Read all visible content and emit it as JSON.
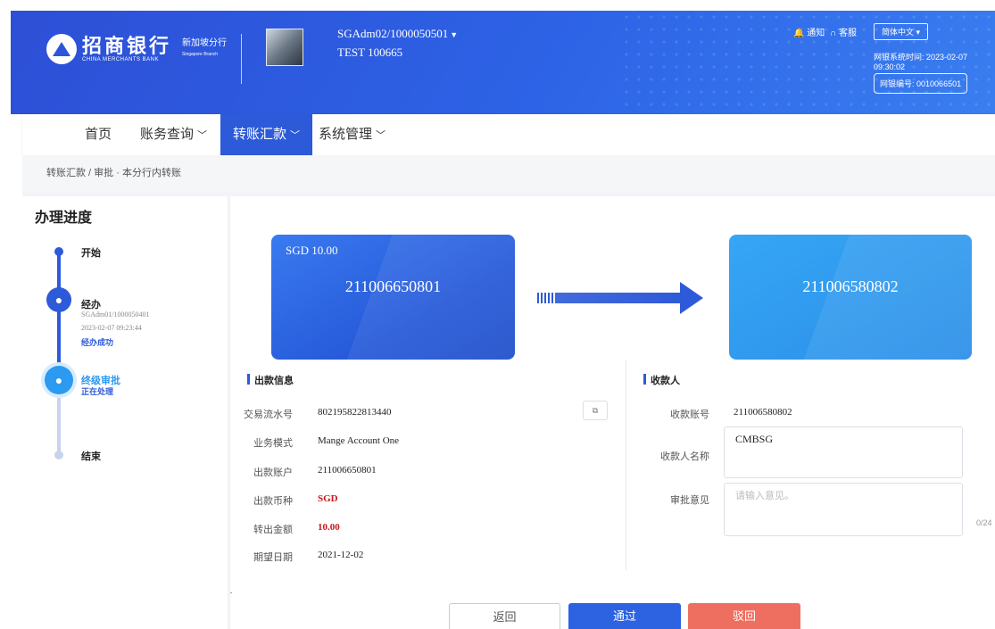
{
  "header": {
    "brand_cn": "招商银行",
    "brand_en": "CHINA MERCHANTS BANK",
    "branch_cn": "新加坡分行",
    "branch_en": "Singapore Branch",
    "user_line1": "SGAdm02/1000050501",
    "user_line2": "TEST 100665",
    "notice_label": "通知",
    "service_label": "客服",
    "language": "简体中文",
    "system_time_label": "网银系统时间:",
    "system_time_value": "2023-02-07 09:30:02",
    "netbank_id_label": "网银编号:",
    "netbank_id_value": "0010066501"
  },
  "nav": {
    "items": [
      {
        "label": "首页"
      },
      {
        "label": "账务查询"
      },
      {
        "label": "转账汇款"
      },
      {
        "label": "系统管理"
      }
    ]
  },
  "breadcrumb": "转账汇款 / 审批 · 本分行内转账",
  "progress": {
    "title": "办理进度",
    "steps": [
      {
        "title": "开始"
      },
      {
        "title": "经办",
        "operator": "SGAdm01/1000050401",
        "time": "2023-02-07 09:23:44",
        "status": "经办成功"
      },
      {
        "title": "终级审批",
        "status": "正在处理"
      },
      {
        "title": "结束"
      }
    ]
  },
  "transfer": {
    "from_currency_amount": "SGD 10.00",
    "from_account": "211006650801",
    "to_account": "211006580802"
  },
  "payer": {
    "section_title": "出款信息",
    "fields": [
      {
        "label": "交易流水号",
        "value": "802195822813440"
      },
      {
        "label": "业务模式",
        "value": "Mange Account One"
      },
      {
        "label": "出款账户",
        "value": "211006650801"
      },
      {
        "label": "出款币种",
        "value": "SGD"
      },
      {
        "label": "转出金额",
        "value": "10.00"
      },
      {
        "label": "期望日期",
        "value": "2021-12-02"
      }
    ]
  },
  "payee": {
    "section_title": "收款人",
    "account_label": "收款账号",
    "account_value": "211006580802",
    "name_label": "收款人名称",
    "name_value": "CMBSG",
    "opinion_label": "审批意见",
    "opinion_placeholder": "请输入意见。",
    "opinion_counter": "0/24"
  },
  "actions": {
    "back": "返回",
    "approve": "通过",
    "reject": "驳回"
  },
  "colors": {
    "primary": "#2d5ad8",
    "reject": "#ee6f5f",
    "emphasis": "#c8161d"
  }
}
